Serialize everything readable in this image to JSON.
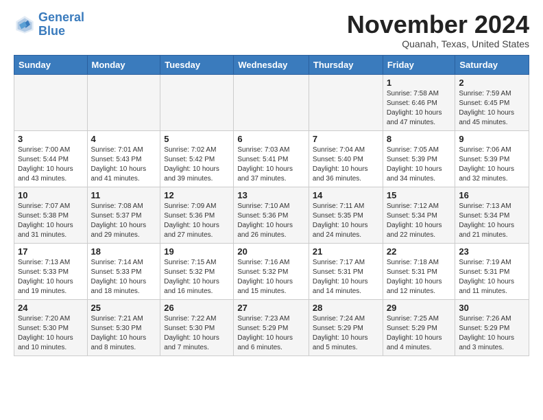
{
  "logo": {
    "line1": "General",
    "line2": "Blue"
  },
  "title": "November 2024",
  "subtitle": "Quanah, Texas, United States",
  "header": {
    "days": [
      "Sunday",
      "Monday",
      "Tuesday",
      "Wednesday",
      "Thursday",
      "Friday",
      "Saturday"
    ]
  },
  "weeks": [
    {
      "cells": [
        {
          "empty": true
        },
        {
          "empty": true
        },
        {
          "empty": true
        },
        {
          "empty": true
        },
        {
          "empty": true
        },
        {
          "day": "1",
          "sunrise": "7:58 AM",
          "sunset": "6:46 PM",
          "daylight": "10 hours and 47 minutes."
        },
        {
          "day": "2",
          "sunrise": "7:59 AM",
          "sunset": "6:45 PM",
          "daylight": "10 hours and 45 minutes."
        }
      ]
    },
    {
      "cells": [
        {
          "day": "3",
          "sunrise": "7:00 AM",
          "sunset": "5:44 PM",
          "daylight": "10 hours and 43 minutes."
        },
        {
          "day": "4",
          "sunrise": "7:01 AM",
          "sunset": "5:43 PM",
          "daylight": "10 hours and 41 minutes."
        },
        {
          "day": "5",
          "sunrise": "7:02 AM",
          "sunset": "5:42 PM",
          "daylight": "10 hours and 39 minutes."
        },
        {
          "day": "6",
          "sunrise": "7:03 AM",
          "sunset": "5:41 PM",
          "daylight": "10 hours and 37 minutes."
        },
        {
          "day": "7",
          "sunrise": "7:04 AM",
          "sunset": "5:40 PM",
          "daylight": "10 hours and 36 minutes."
        },
        {
          "day": "8",
          "sunrise": "7:05 AM",
          "sunset": "5:39 PM",
          "daylight": "10 hours and 34 minutes."
        },
        {
          "day": "9",
          "sunrise": "7:06 AM",
          "sunset": "5:39 PM",
          "daylight": "10 hours and 32 minutes."
        }
      ]
    },
    {
      "cells": [
        {
          "day": "10",
          "sunrise": "7:07 AM",
          "sunset": "5:38 PM",
          "daylight": "10 hours and 31 minutes."
        },
        {
          "day": "11",
          "sunrise": "7:08 AM",
          "sunset": "5:37 PM",
          "daylight": "10 hours and 29 minutes."
        },
        {
          "day": "12",
          "sunrise": "7:09 AM",
          "sunset": "5:36 PM",
          "daylight": "10 hours and 27 minutes."
        },
        {
          "day": "13",
          "sunrise": "7:10 AM",
          "sunset": "5:36 PM",
          "daylight": "10 hours and 26 minutes."
        },
        {
          "day": "14",
          "sunrise": "7:11 AM",
          "sunset": "5:35 PM",
          "daylight": "10 hours and 24 minutes."
        },
        {
          "day": "15",
          "sunrise": "7:12 AM",
          "sunset": "5:34 PM",
          "daylight": "10 hours and 22 minutes."
        },
        {
          "day": "16",
          "sunrise": "7:13 AM",
          "sunset": "5:34 PM",
          "daylight": "10 hours and 21 minutes."
        }
      ]
    },
    {
      "cells": [
        {
          "day": "17",
          "sunrise": "7:13 AM",
          "sunset": "5:33 PM",
          "daylight": "10 hours and 19 minutes."
        },
        {
          "day": "18",
          "sunrise": "7:14 AM",
          "sunset": "5:33 PM",
          "daylight": "10 hours and 18 minutes."
        },
        {
          "day": "19",
          "sunrise": "7:15 AM",
          "sunset": "5:32 PM",
          "daylight": "10 hours and 16 minutes."
        },
        {
          "day": "20",
          "sunrise": "7:16 AM",
          "sunset": "5:32 PM",
          "daylight": "10 hours and 15 minutes."
        },
        {
          "day": "21",
          "sunrise": "7:17 AM",
          "sunset": "5:31 PM",
          "daylight": "10 hours and 14 minutes."
        },
        {
          "day": "22",
          "sunrise": "7:18 AM",
          "sunset": "5:31 PM",
          "daylight": "10 hours and 12 minutes."
        },
        {
          "day": "23",
          "sunrise": "7:19 AM",
          "sunset": "5:31 PM",
          "daylight": "10 hours and 11 minutes."
        }
      ]
    },
    {
      "cells": [
        {
          "day": "24",
          "sunrise": "7:20 AM",
          "sunset": "5:30 PM",
          "daylight": "10 hours and 10 minutes."
        },
        {
          "day": "25",
          "sunrise": "7:21 AM",
          "sunset": "5:30 PM",
          "daylight": "10 hours and 8 minutes."
        },
        {
          "day": "26",
          "sunrise": "7:22 AM",
          "sunset": "5:30 PM",
          "daylight": "10 hours and 7 minutes."
        },
        {
          "day": "27",
          "sunrise": "7:23 AM",
          "sunset": "5:29 PM",
          "daylight": "10 hours and 6 minutes."
        },
        {
          "day": "28",
          "sunrise": "7:24 AM",
          "sunset": "5:29 PM",
          "daylight": "10 hours and 5 minutes."
        },
        {
          "day": "29",
          "sunrise": "7:25 AM",
          "sunset": "5:29 PM",
          "daylight": "10 hours and 4 minutes."
        },
        {
          "day": "30",
          "sunrise": "7:26 AM",
          "sunset": "5:29 PM",
          "daylight": "10 hours and 3 minutes."
        }
      ]
    }
  ]
}
